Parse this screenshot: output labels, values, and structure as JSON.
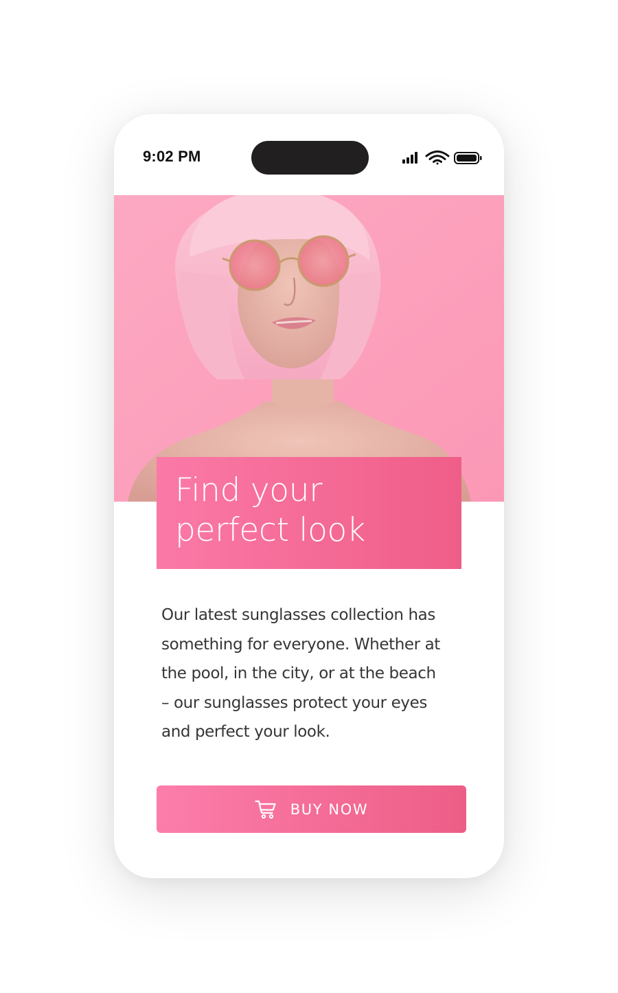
{
  "status_bar": {
    "time": "9:02 PM",
    "icons": [
      "cellular-signal-icon",
      "wifi-icon",
      "battery-icon"
    ]
  },
  "hero": {
    "image": "woman-pink-bob-sunglasses-photo",
    "background_color": "#fda0bd"
  },
  "headline": {
    "lines": [
      "Find your",
      "perfect look"
    ],
    "gradient": [
      "#fb79a7",
      "#ef5e88"
    ]
  },
  "description": {
    "lines": [
      "Our latest sunglasses collection has",
      "something for everyone. Whether at",
      "the pool, in the city, or at the beach",
      "– our sunglasses protect your eyes",
      "and perfect your look."
    ]
  },
  "buy_button": {
    "label": "BUY NOW",
    "icon": "shopping-cart-icon",
    "gradient": [
      "#fc7dab",
      "#ed5e86"
    ]
  }
}
